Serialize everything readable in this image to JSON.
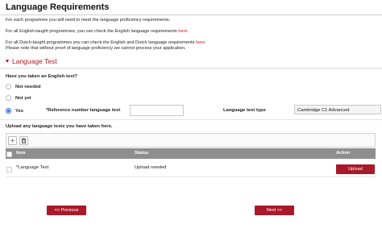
{
  "page": {
    "title": "Language Requirements",
    "intro": "For each programme you will need to meet the language proficiency requirements.",
    "english_line": "For all English-taught programmes, you can check the English language requirements",
    "english_link": "here.",
    "dutch_line": "For all Dutch-taught programmes you can check the English and Dutch language requirements",
    "dutch_link": "here.",
    "note_line": "Please note that without proof of language proficiency we cannot process your application."
  },
  "section": {
    "title": "Language Test"
  },
  "question": {
    "label": "Have you taken an English test?",
    "options": [
      {
        "label": "Not needed",
        "selected": false
      },
      {
        "label": "Not yet",
        "selected": false
      },
      {
        "label": "Yes",
        "selected": true
      }
    ]
  },
  "fields": {
    "reference_label": "*Reference number language test",
    "reference_value": "",
    "test_type_label": "Language test type",
    "test_type_value": "Cambridge C1 Advanced"
  },
  "upload": {
    "title": "Upload any language tests you have taken here.",
    "toolbar": {
      "add_icon": "plus-icon",
      "delete_icon": "trash-icon"
    },
    "columns": [
      "Item",
      "Status",
      "Action"
    ],
    "rows": [
      {
        "item": "*Language Test",
        "status": "Upload needed",
        "action": "Upload"
      }
    ]
  },
  "nav": {
    "previous": "<< Previous",
    "next": "Next >>"
  },
  "colors": {
    "accent": "#b3171f",
    "button": "#a8192a",
    "table_header": "#8e8e8e",
    "radio_selected": "#3a6fd8"
  }
}
